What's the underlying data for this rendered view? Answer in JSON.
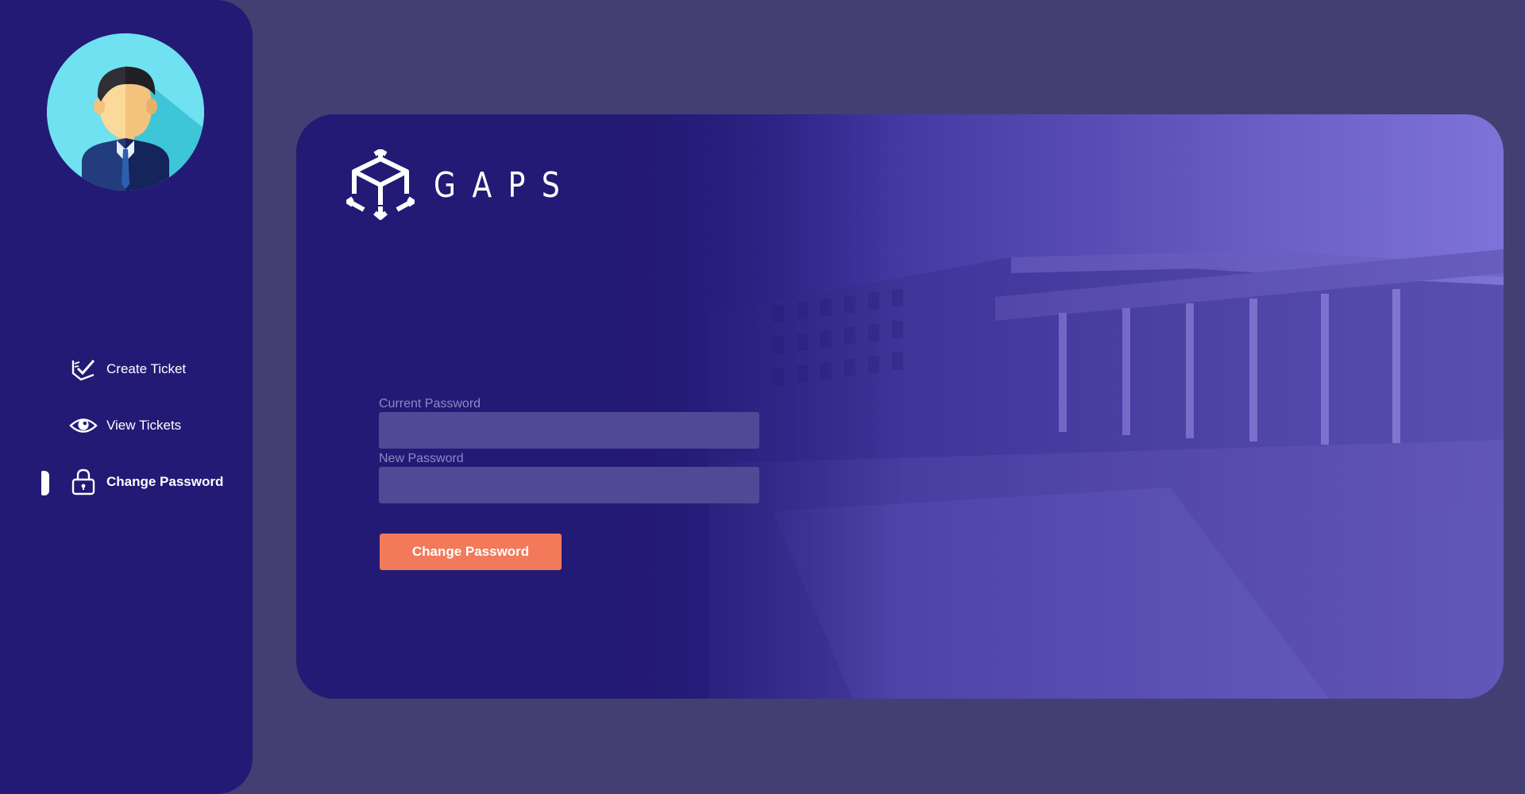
{
  "sidebar": {
    "items": [
      {
        "label": "Create Ticket",
        "icon": "create-ticket-icon",
        "active": false
      },
      {
        "label": "View Tickets",
        "icon": "eye-icon",
        "active": false
      },
      {
        "label": "Change Password",
        "icon": "lock-icon",
        "active": true
      }
    ]
  },
  "brand": {
    "name": "GAPS",
    "logo": "cube-logo-icon"
  },
  "form": {
    "current_password_label": "Current Password",
    "current_password_value": "",
    "new_password_label": "New Password",
    "new_password_value": "",
    "submit_label": "Change Password"
  },
  "colors": {
    "page_bg": "#433f72",
    "sidebar_bg": "#231a75",
    "accent": "#f2795a",
    "input_bg": "#504a96"
  }
}
